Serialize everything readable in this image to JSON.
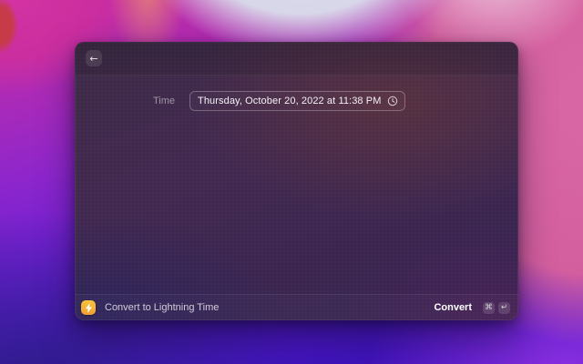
{
  "window": {
    "header": {
      "back_icon": "←"
    },
    "form": {
      "label": "Time",
      "value": "Thursday, October 20, 2022 at 11:38 PM"
    },
    "action_bar": {
      "command_title": "Convert to Lightning Time",
      "primary_action_label": "Convert",
      "shortcut": {
        "modifier_key": "⌘",
        "enter_key": "↵"
      }
    }
  },
  "colors": {
    "extension_icon_bg": "#f0a031",
    "accent_magenta": "#c9309f",
    "accent_purple": "#6f1fd2"
  }
}
